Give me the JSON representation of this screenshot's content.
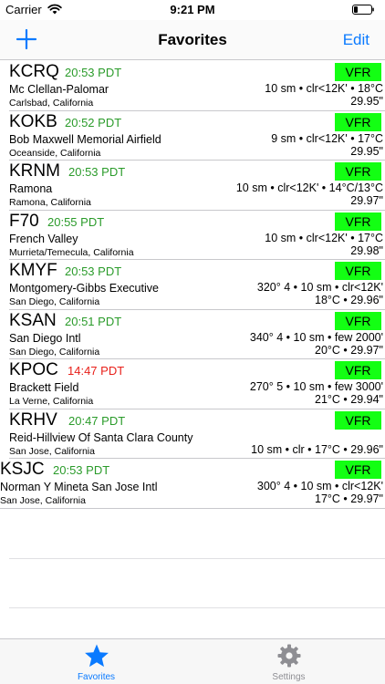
{
  "status": {
    "carrier": "Carrier",
    "time": "9:21 PM"
  },
  "nav": {
    "title": "Favorites",
    "edit_label": "Edit",
    "add_icon": "plus-icon"
  },
  "colors": {
    "accent": "#0a7aff",
    "time_ok": "#2a9b2a",
    "time_stale": "#e8201a",
    "vfr": "#13ff13",
    "tab_inactive": "#8e8e93"
  },
  "favorites": [
    {
      "ident": "KCRQ",
      "time": "20:53 PDT",
      "stale": false,
      "name": "Mc Clellan-Palomar",
      "city": "Carlsbad, California",
      "category": "VFR",
      "line1": "10 sm • clr<12K' • 18°C",
      "line2": "29.95\""
    },
    {
      "ident": "KOKB",
      "time": "20:52 PDT",
      "stale": false,
      "name": "Bob Maxwell Memorial Airfield",
      "city": "Oceanside, California",
      "category": "VFR",
      "line1": "9 sm • clr<12K' • 17°C",
      "line2": "29.95\""
    },
    {
      "ident": "KRNM",
      "time": "20:53 PDT",
      "stale": false,
      "name": "Ramona",
      "city": "Ramona, California",
      "category": "VFR",
      "line1": "10 sm • clr<12K' • 14°C/13°C",
      "line2": "29.97\""
    },
    {
      "ident": "F70",
      "time": "20:55 PDT",
      "stale": false,
      "name": "French Valley",
      "city": "Murrieta/Temecula, California",
      "category": "VFR",
      "line1": "10 sm • clr<12K' • 17°C",
      "line2": "29.98\""
    },
    {
      "ident": "KMYF",
      "time": "20:53 PDT",
      "stale": false,
      "name": "Montgomery-Gibbs Executive",
      "city": "San Diego, California",
      "category": "VFR",
      "line1": "320° 4 • 10 sm • clr<12K'",
      "line2": "18°C • 29.96\""
    },
    {
      "ident": "KSAN",
      "time": "20:51 PDT",
      "stale": false,
      "name": "San Diego Intl",
      "city": "San Diego, California",
      "category": "VFR",
      "line1": "340° 4 • 10 sm • few 2000'",
      "line2": "20°C • 29.97\""
    },
    {
      "ident": "KPOC",
      "time": "14:47 PDT",
      "stale": true,
      "name": "Brackett Field",
      "city": "La Verne, California",
      "category": "VFR",
      "line1": "270° 5 • 10 sm • few 3000'",
      "line2": "21°C • 29.94\""
    },
    {
      "ident": "KRHV",
      "time": "20:47 PDT",
      "stale": false,
      "name": "Reid-Hillview Of Santa Clara County",
      "city": "San Jose, California",
      "category": "VFR",
      "line1": "",
      "line2": "10 sm • clr • 17°C • 29.96\""
    },
    {
      "ident": "KSJC",
      "time": "20:53 PDT",
      "stale": false,
      "name": "Norman Y Mineta San Jose Intl",
      "city": "San Jose, California",
      "category": "VFR",
      "line1": "300° 4 • 10 sm • clr<12K'",
      "line2": "17°C • 29.97\""
    }
  ],
  "tabs": [
    {
      "label": "Favorites",
      "icon": "star-icon",
      "active": true
    },
    {
      "label": "Settings",
      "icon": "gear-icon",
      "active": false
    }
  ]
}
